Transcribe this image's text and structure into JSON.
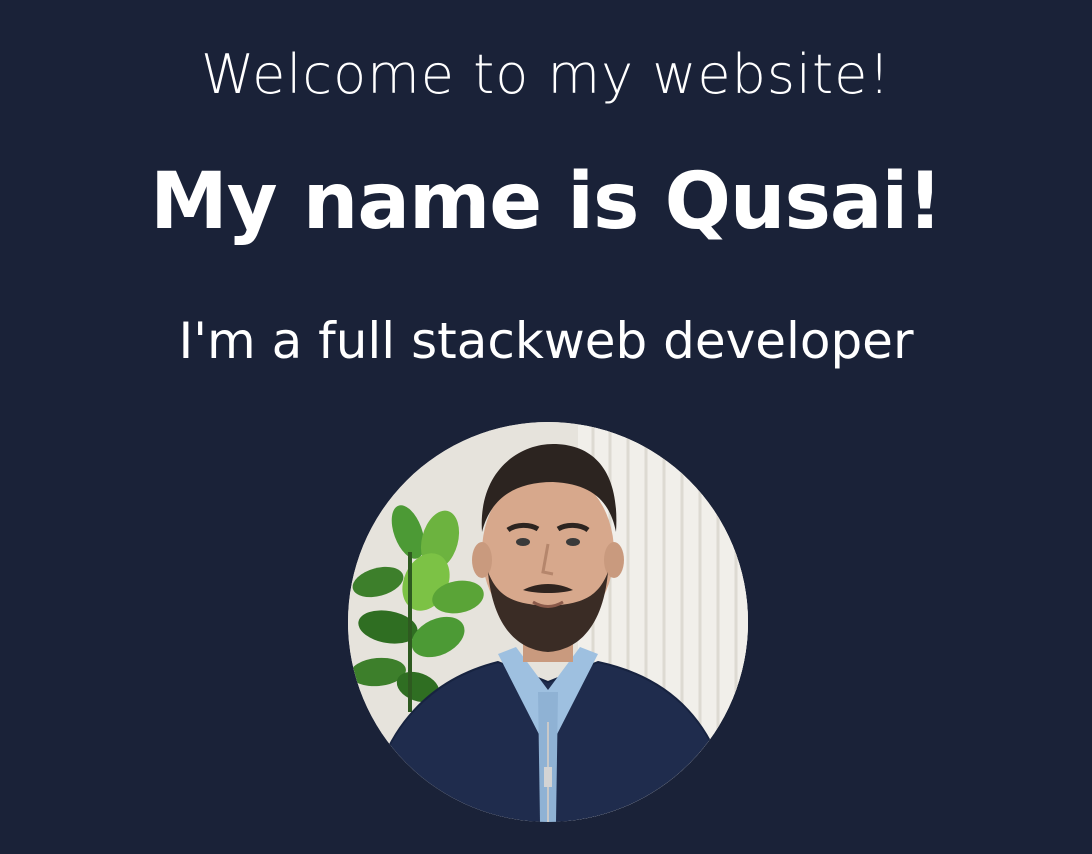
{
  "hero": {
    "greeting": "Welcome to my website!",
    "name": "My name is Qusai!",
    "role": "I'm a full stackweb developer"
  },
  "avatar": {
    "kind": "profile-photo",
    "description_icon": "portrait-photo"
  },
  "colors": {
    "background": "#1a2238",
    "text": "#ffffff"
  }
}
